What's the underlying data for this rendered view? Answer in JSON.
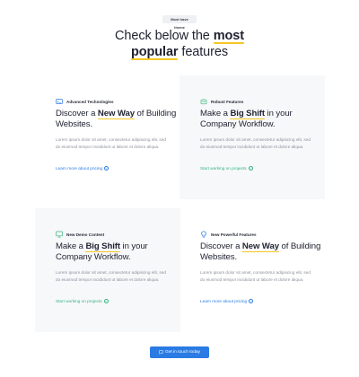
{
  "badge": "Most have theme",
  "headline": {
    "part1": "Check below the ",
    "hl1": "most",
    "hl2": "popular",
    "part2": " features"
  },
  "cards": [
    {
      "label": "Advanced Technologies",
      "icon": "tech-icon",
      "title_pre": "Discover a ",
      "title_hl": "New Way",
      "title_post": " of Building Websites.",
      "body": "Lorem ipsum dolor sit amet, consectetur adipiscing elit, sed do eiusmod tempor incididunt ut labore et dolore aliqua.",
      "link": "Learn more about pricing",
      "link_color": "#2a7be4"
    },
    {
      "label": "Robust Features",
      "icon": "robot-icon",
      "title_pre": "Make a ",
      "title_hl": "Big Shift",
      "title_post": " in your Company Workflow.",
      "body": "Lorem ipsum dolor sit amet, consectetur adipiscing elit, sed do eiusmod tempor incididunt ut labore et dolore aliqua.",
      "link": "Start working on projects",
      "link_color": "#36b37e"
    },
    {
      "label": "New Demo Content",
      "icon": "monitor-icon",
      "title_pre": "Make a ",
      "title_hl": "Big Shift",
      "title_post": " in your Company Workflow.",
      "body": "Lorem ipsum dolor sit amet, consectetur adipiscing elit, sed do eiusmod tempor incididunt ut labore et dolore aliqua.",
      "link": "Start working on projects",
      "link_color": "#36b37e"
    },
    {
      "label": "New Powerful Features",
      "icon": "bulb-icon",
      "title_pre": "Discover a ",
      "title_hl": "New Way",
      "title_post": " of Building Websites.",
      "body": "Lorem ipsum dolor sit amet, consectetur adipiscing elit, sed do eiusmod tempor incididunt ut labore et dolore aliqua.",
      "link": "Learn more about pricing",
      "link_color": "#2a7be4"
    }
  ],
  "cta": {
    "label": "Get in touch today",
    "icon": "chat-icon",
    "color": "#2a7be4"
  },
  "colors": {
    "accent_blue": "#2a7be4",
    "accent_green": "#36b37e",
    "highlight": "#f6c623",
    "card_bg": "#f7f8fa"
  }
}
